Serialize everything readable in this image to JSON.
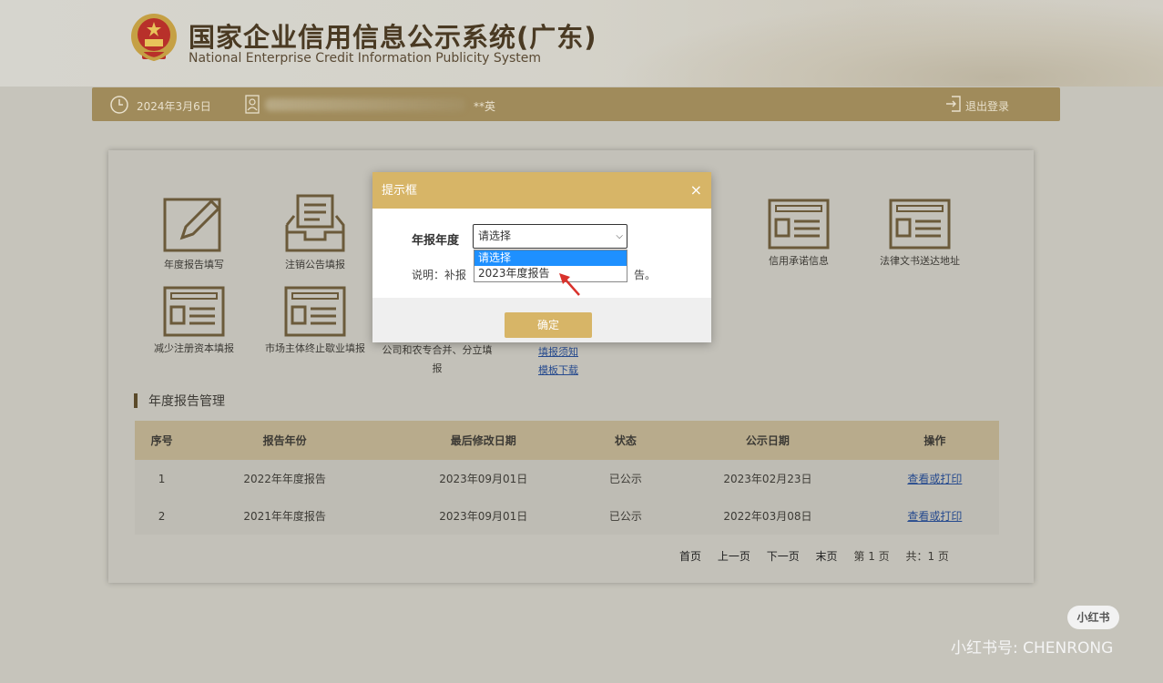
{
  "header": {
    "title_cn": "国家企业信用信息公示系统(广东)",
    "title_en": "National Enterprise Credit Information Publicity System"
  },
  "topbar": {
    "date": "2024年3月6日",
    "user_suffix": "**英",
    "logout_label": "退出登录"
  },
  "tiles": [
    {
      "label": "年度报告填写",
      "icon": "edit-doc-icon"
    },
    {
      "label": "注销公告填报",
      "icon": "inbox-doc-icon"
    },
    {
      "label": "信用承诺信息",
      "icon": "form-card-icon"
    },
    {
      "label": "法律文书送达地址",
      "icon": "form-card-icon"
    },
    {
      "label": "减少注册资本填报",
      "icon": "form-card-icon"
    },
    {
      "label": "市场主体终止歇业填报",
      "icon": "form-card-icon"
    },
    {
      "label": "公司和农专合并、分立填报",
      "icon": null
    }
  ],
  "links": {
    "guide": "填报须知",
    "template": "模板下载"
  },
  "section_title": "年度报告管理",
  "table": {
    "headers": [
      "序号",
      "报告年份",
      "最后修改日期",
      "状态",
      "公示日期",
      "操作"
    ],
    "rows": [
      {
        "no": "1",
        "year": "2022年年度报告",
        "modified": "2023年09月01日",
        "status": "已公示",
        "publish": "2023年02月23日",
        "action": "查看或打印"
      },
      {
        "no": "2",
        "year": "2021年年度报告",
        "modified": "2023年09月01日",
        "status": "已公示",
        "publish": "2022年03月08日",
        "action": "查看或打印"
      }
    ]
  },
  "pager": {
    "first": "首页",
    "prev": "上一页",
    "next": "下一页",
    "last": "末页",
    "current": "第 1 页",
    "total": "共：1 页"
  },
  "modal": {
    "title": "提示框",
    "close": "×",
    "field_label": "年报年度",
    "select_value": "请选择",
    "note_prefix": "说明：补报",
    "note_suffix": "告。",
    "ok_label": "确定"
  },
  "dropdown": {
    "options": [
      "请选择",
      "2023年度报告"
    ],
    "highlighted": 0
  },
  "watermark": {
    "badge": "小红书",
    "text": "小红书号: CHENRONG"
  },
  "colors": {
    "accent_gold": "#d7b567",
    "bar_brown": "#a08b5b",
    "link_blue": "#264a8e",
    "arrow_red": "#d9322c",
    "highlight_blue": "#1e90ff"
  }
}
